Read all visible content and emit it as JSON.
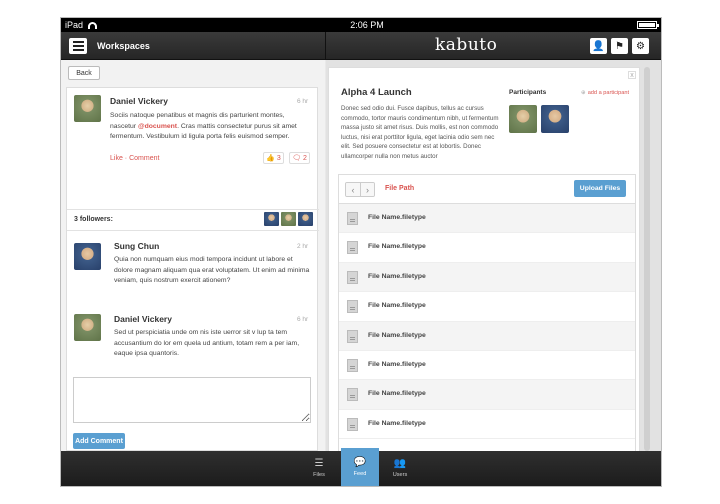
{
  "status_bar": {
    "device": "iPad",
    "time": "2:06 PM"
  },
  "header": {
    "menu_icon": "hamburger-icon",
    "section_title": "Workspaces",
    "brand": "kabuto",
    "actions": [
      {
        "icon": "user-icon",
        "glyph": "👤"
      },
      {
        "icon": "flag-icon",
        "glyph": "⚑"
      },
      {
        "icon": "gear-icon",
        "glyph": "⚙"
      }
    ]
  },
  "left": {
    "back_label": "Back",
    "post": {
      "author": "Daniel Vickery",
      "time": "6 hr",
      "text_before": "Sociis natoque penatibus et magnis dis parturient montes, nascetur ",
      "mention": "@document",
      "text_after": ". Cras mattis consectetur purus sit amet fermentum. Vestibulum id ligula porta felis euismod semper.",
      "like_label": "Like",
      "dot": "·",
      "comment_label": "Comment",
      "likes": "3",
      "comments": "2"
    },
    "followers_label": "3 followers:",
    "comments": [
      {
        "author": "Sung Chun",
        "time": "2 hr",
        "text": "Quia non numquam eius modi tempora incidunt ut labore et dolore magnam aliquam qua erat voluptatem. Ut enim ad minima veniam, quis nostrum exercit ationem?"
      },
      {
        "author": "Daniel Vickery",
        "time": "6 hr",
        "text": "Sed ut perspiciatia unde om nis iste uerror sit v lup ta tem accusantium do lor em quela ud antium, totam rem a per iam, eaque ipsa quantoris."
      }
    ],
    "comment_placeholder": "",
    "add_comment_label": "Add Comment"
  },
  "detail": {
    "close": "x",
    "title": "Alpha 4 Launch",
    "description": "Donec sed odio dui. Fusce dapibus, tellus ac cursus commodo, tortor mauris condimentum nibh, ut fermentum massa justo sit amet risus. Duis mollis, est non commodo luctus, nisi erat porttitor ligula, eget lacinia odio sem nec elit. Sed posuere consectetur est at lobortis. Donec ullamcorper nulla non metus auctor",
    "participants_label": "Participants",
    "add_participant_label": "add a participant",
    "file_path_label": "File Path",
    "upload_label": "Upload Files",
    "files": [
      "File Name.filetype",
      "File Name.filetype",
      "File Name.filetype",
      "File Name.filetype",
      "File Name.filetype",
      "File Name.filetype",
      "File Name.filetype",
      "File Name.filetype"
    ]
  },
  "tabs": [
    {
      "label": "Files",
      "icon": "list-icon",
      "glyph": "☰",
      "active": false
    },
    {
      "label": "Feed",
      "icon": "chat-bubble-icon",
      "glyph": "💬",
      "active": true
    },
    {
      "label": "Users",
      "icon": "users-icon",
      "glyph": "👥",
      "active": false
    }
  ],
  "colors": {
    "accent": "#5a9fd1",
    "link": "#d9534f",
    "header_bg": "#2b2b2b"
  }
}
